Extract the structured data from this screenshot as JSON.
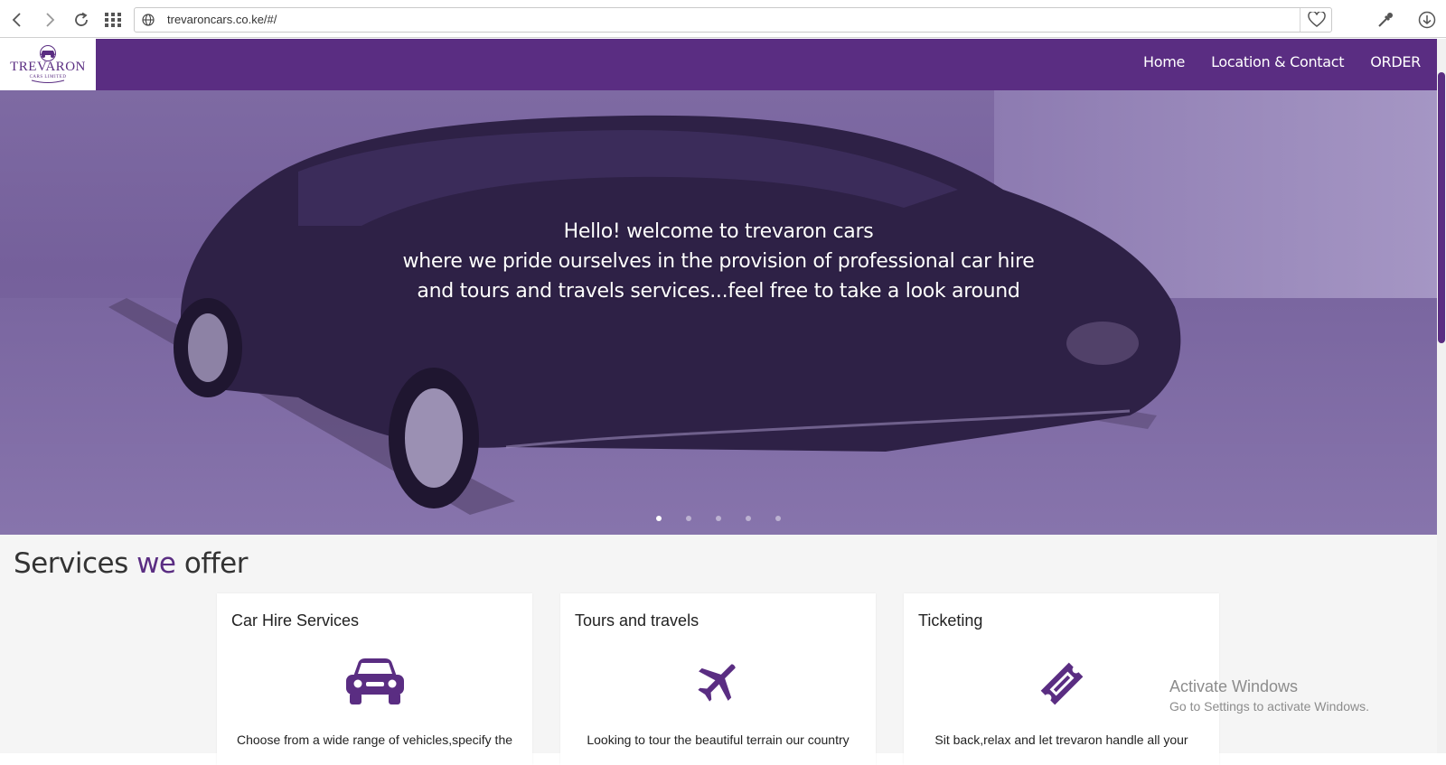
{
  "browser": {
    "url": "trevaroncars.co.ke/#/"
  },
  "header": {
    "logo_text": "TREVARON",
    "logo_subtext": "CARS LIMITED",
    "nav": [
      {
        "label": "Home"
      },
      {
        "label": "Location & Contact"
      },
      {
        "label": "ORDER"
      }
    ]
  },
  "hero": {
    "caption_lines": [
      "Hello! welcome to trevaron cars",
      "where we pride ourselves in the provision of professional car hire",
      "and tours and travels services...feel free to take a look around"
    ],
    "slide_count": 5,
    "active_slide": 1
  },
  "services": {
    "title_part1": "Services ",
    "title_accent": "we",
    "title_part2": " offer",
    "cards": [
      {
        "title": "Car Hire Services",
        "icon": "car-icon",
        "description": "Choose from a wide range of vehicles,specify the"
      },
      {
        "title": "Tours and travels",
        "icon": "plane-icon",
        "description": "Looking to tour the beautiful terrain our country"
      },
      {
        "title": "Ticketing",
        "icon": "ticket-icon",
        "description": "Sit back,relax and let trevaron handle all your"
      }
    ]
  },
  "watermark": {
    "title": "Activate Windows",
    "subtitle": "Go to Settings to activate Windows."
  },
  "colors": {
    "brand_purple": "#5a2d82",
    "page_bg": "#f5f5f5"
  }
}
